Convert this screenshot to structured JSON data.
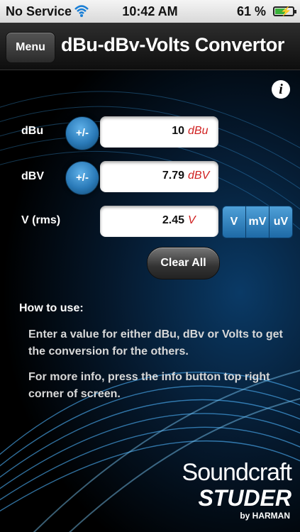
{
  "status_bar": {
    "carrier": "No Service",
    "time": "10:42 AM",
    "battery": "61 %",
    "battery_level": 0.61,
    "wifi_icon": "wifi-icon",
    "battery_icon": "battery-charging-icon"
  },
  "nav": {
    "menu_label": "Menu",
    "title": "dBu-dBv-Volts Convertor"
  },
  "info_icon": {
    "glyph": "i",
    "icon": "info-icon"
  },
  "rows": [
    {
      "label": "dBu",
      "toggle": "+/-",
      "value": "10",
      "unit": "dBu"
    },
    {
      "label": "dBV",
      "toggle": "+/-",
      "value": "7.79",
      "unit": "dBV"
    },
    {
      "label": "V (rms)",
      "value": "2.45",
      "unit": "V"
    }
  ],
  "voltage_units": [
    "V",
    "mV",
    "uV"
  ],
  "clear_label": "Clear All",
  "how_to": {
    "title": "How to use:",
    "paragraphs": [
      "Enter a value for either dBu, dBv or Volts to get the conversion for the others.",
      "For more info, press the info button top right corner of screen."
    ]
  },
  "branding": {
    "line1": "Soundcraft",
    "line2": "STUDER",
    "line3": "by HARMAN"
  },
  "colors": {
    "accent_blue": "#2a7ab8",
    "unit_red": "#d02020",
    "background": "#000000"
  }
}
